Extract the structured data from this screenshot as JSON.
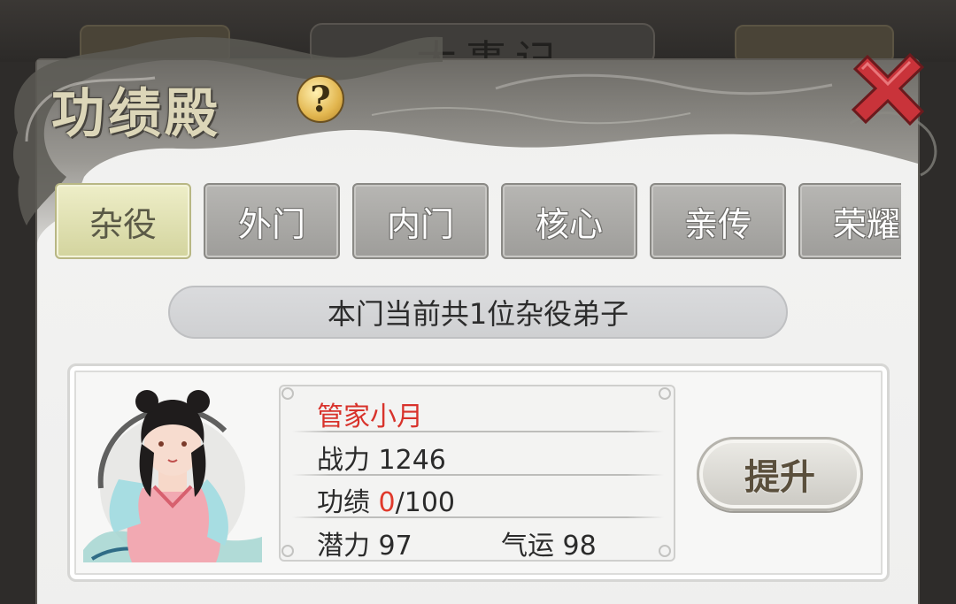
{
  "background": {
    "title_fragment": "大事记"
  },
  "panel": {
    "title": "功绩殿",
    "help_symbol": "?",
    "close_symbol": "✕"
  },
  "tabs": [
    {
      "label": "杂役",
      "active": true
    },
    {
      "label": "外门",
      "active": false
    },
    {
      "label": "内门",
      "active": false
    },
    {
      "label": "核心",
      "active": false
    },
    {
      "label": "亲传",
      "active": false
    },
    {
      "label": "荣耀",
      "active": false
    }
  ],
  "banner": {
    "text": "本门当前共1位杂役弟子"
  },
  "disciple": {
    "name": "管家小月",
    "power_label": "战力",
    "power_value": "1246",
    "merit_label": "功绩",
    "merit_current": "0",
    "merit_max": "/100",
    "potential_label": "潜力",
    "potential_value": "97",
    "luck_label": "气运",
    "luck_value": "98",
    "upgrade_label": "提升"
  },
  "colors": {
    "accent_red": "#d8322b",
    "tab_active": "#d3d49e",
    "tab_inactive": "#a9a8a5"
  }
}
